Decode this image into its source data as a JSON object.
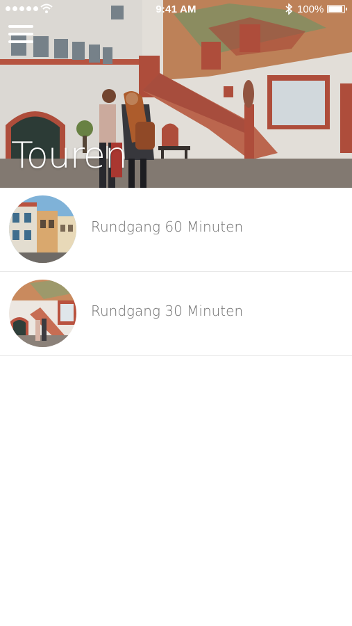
{
  "status_bar": {
    "time": "9:41 AM",
    "battery": "100%",
    "battery_level": 1.0,
    "signal_icon": "signal-dots-icon",
    "wifi_icon": "wifi-icon",
    "bluetooth_icon": "bluetooth-icon"
  },
  "header": {
    "menu_icon": "hamburger-menu-icon",
    "title": "Touren"
  },
  "tours": [
    {
      "label": "Rundgang 60 Minuten",
      "thumb_icon": "street-photo-thumbnail"
    },
    {
      "label": "Rundgang 30 Minuten",
      "thumb_icon": "courtyard-photo-thumbnail"
    }
  ],
  "colors": {
    "label_text": "#6f6f6f",
    "divider": "#e6e6e6",
    "facade_red": "#b9523f"
  }
}
